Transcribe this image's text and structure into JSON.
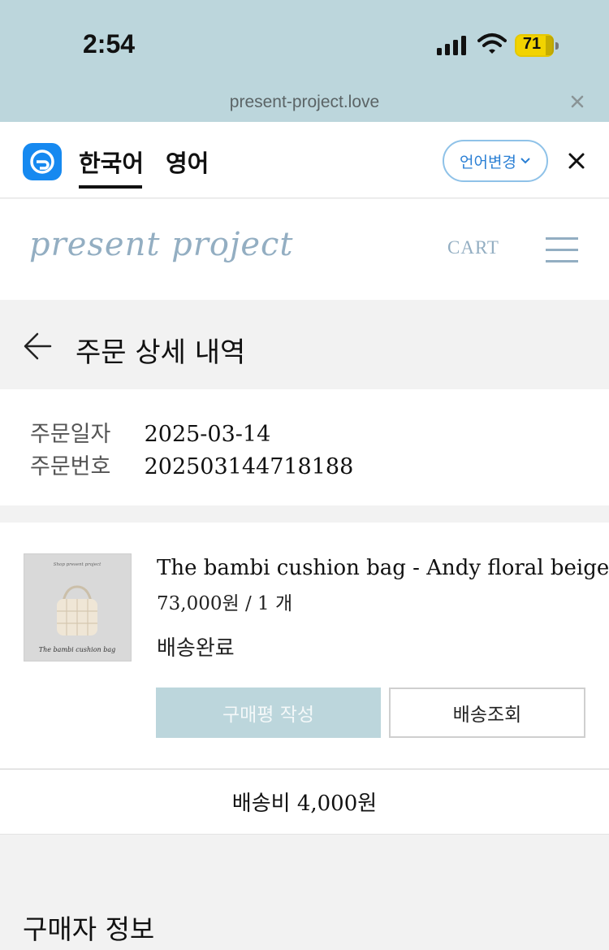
{
  "status_bar": {
    "time": "2:54",
    "battery": "71",
    "icons": [
      "signal-icon",
      "wifi-icon",
      "battery-icon"
    ]
  },
  "browser": {
    "url": "present-project.love"
  },
  "translate_bar": {
    "active_language": "한국어",
    "other_language": "영어",
    "change_button": "언어변경"
  },
  "site": {
    "logo": "present project",
    "cart": "CART"
  },
  "page": {
    "title": "주문 상세 내역"
  },
  "order": {
    "date_label": "주문일자",
    "date_value": "2025-03-14",
    "number_label": "주문번호",
    "number_value": "202503144718188"
  },
  "product": {
    "name": "The bambi cushion bag - Andy floral beige",
    "price_qty": "73,000원 / 1 개",
    "status": "배송완료",
    "review_button": "구매평 작성",
    "track_button": "배송조회",
    "thumb_text_top": "Shop present project",
    "thumb_text_bottom": "The bambi cushion bag"
  },
  "shipping": {
    "fee": "배송비 4,000원"
  },
  "buyer": {
    "title": "구매자 정보"
  },
  "colors": {
    "accent": "#bcd6dc",
    "logo": "#93aec2",
    "translate_blue": "#1689f0",
    "battery": "#f2d300"
  }
}
